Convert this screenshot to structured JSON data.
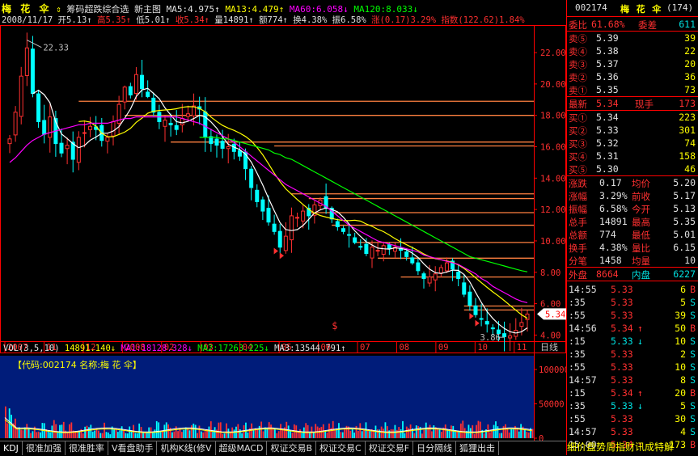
{
  "stock": {
    "name": "梅 花 伞",
    "code": "002174",
    "count": "(174)"
  },
  "header": {
    "indicator_label": "筹码超跌综合选",
    "mode_label": "新主图",
    "ma5": "MA5:4.975↑",
    "ma13": "MA13:4.479↑",
    "ma60": "MA60:6.058↓",
    "ma120": "MA120:8.033↓"
  },
  "quote_line": {
    "date": "2008/11/17",
    "open": "开5.13↑",
    "high": "高5.35↑",
    "low": "低5.01↑",
    "close": "收5.34↑",
    "volume": "量14891↑",
    "amount": "额774↑",
    "turnover": "换4.38%",
    "amplitude": "振6.58%",
    "change": "涨(0.17)3.29%",
    "index": "指数(122.62)1.84%"
  },
  "volume_line": {
    "label": "VOL(3,5,10)",
    "vol": "14891.140↓",
    "ma1": "MA1:18128.328↓",
    "ma2": "MA2:17263.225↓",
    "ma3": "MA3:13544.791↑"
  },
  "volume_banner": "【代码:002174 名称:梅 花 伞】",
  "colors": {
    "up": "#ff3030",
    "down": "#00ffff",
    "ma5": "#ffffff",
    "ma13": "#ffff00",
    "ma60": "#ff00ff",
    "ma120": "#00ff00",
    "level": "#ff8040",
    "axis": "#ff0000"
  },
  "chart_data": {
    "type": "candlestick",
    "y_ticks": [
      "22.00",
      "20.00",
      "18.00",
      "16.00",
      "14.00",
      "12.00",
      "10.00",
      "8.00",
      "6.00",
      "4.00"
    ],
    "ylim": [
      3.3,
      23.6
    ],
    "x_ticks": [
      "2007",
      "11",
      "12",
      "2008",
      "02",
      "03",
      "04",
      "05",
      "06",
      "07",
      "08",
      "09",
      "10",
      "11"
    ],
    "x_axis_label": "日线",
    "annotations": {
      "high": "22.33",
      "low": "3.86",
      "last": "5.34",
      "marker": "$"
    },
    "levels": [
      18.9,
      18.0,
      16.3,
      16.05,
      13.0,
      12.7,
      11.8,
      11.0,
      9.9,
      8.9,
      7.7,
      5.85,
      5.6
    ],
    "closes": [
      16.5,
      18.2,
      20.5,
      22.3,
      19.4,
      17.6,
      16.8,
      17.9,
      16.2,
      15.6,
      16.1,
      15.2,
      16.6,
      16.9,
      17.3,
      17.1,
      16.4,
      16.6,
      17.6,
      18.7,
      19.8,
      19.3,
      20.6,
      19.7,
      19.2,
      18.2,
      17.6,
      17.7,
      17.4,
      17.1,
      17.8,
      18.1,
      18.6,
      18.4,
      16.6,
      16.2,
      16.1,
      15.9,
      16.0,
      15.7,
      15.4,
      14.6,
      13.4,
      12.5,
      11.9,
      11.2,
      10.6,
      9.6,
      10.3,
      11.6,
      11.5,
      11.9,
      11.6,
      12.3,
      12.6,
      12.1,
      11.4,
      10.9,
      10.6,
      10.4,
      9.9,
      9.6,
      9.2,
      9.6,
      9.4,
      9.7,
      9.5,
      9.6,
      9.4,
      9.0,
      8.6,
      8.1,
      7.6,
      7.7,
      7.9,
      8.3,
      8.6,
      8.2,
      7.6,
      6.6,
      5.9,
      5.3,
      5.0,
      4.7,
      4.4,
      4.1,
      3.9,
      3.95,
      4.3,
      4.8,
      5.34
    ],
    "ma60": [
      15.0,
      15.3,
      15.7,
      16.1,
      16.4,
      16.6,
      16.8,
      16.9,
      17.0,
      17.1,
      17.2,
      17.3,
      17.4,
      17.4,
      17.5,
      17.5,
      17.5,
      17.5,
      17.6,
      17.7,
      17.8,
      17.8,
      17.9,
      17.9,
      17.9,
      17.9,
      17.9,
      17.9,
      17.9,
      17.9,
      17.8,
      17.7,
      17.6,
      17.5,
      17.3,
      17.1,
      16.9,
      16.7,
      16.5,
      16.3,
      16.0,
      15.7,
      15.4,
      15.1,
      14.8,
      14.5,
      14.2,
      13.9,
      13.6,
      13.4,
      13.2,
      13.0,
      12.8,
      12.6,
      12.4,
      12.2,
      11.9,
      11.6,
      11.3,
      11.0,
      10.8,
      10.6,
      10.4,
      10.2,
      10.0,
      9.9,
      9.8,
      9.7,
      9.6,
      9.5,
      9.4,
      9.3,
      9.1,
      9.0,
      8.9,
      8.8,
      8.7,
      8.6,
      8.5,
      8.3,
      8.1,
      7.9,
      7.6,
      7.4,
      7.1,
      6.9,
      6.7,
      6.5,
      6.3,
      6.15,
      6.06
    ],
    "ma120": [
      null,
      null,
      null,
      null,
      null,
      null,
      null,
      null,
      null,
      null,
      null,
      null,
      null,
      null,
      null,
      null,
      null,
      null,
      null,
      null,
      null,
      null,
      null,
      null,
      null,
      null,
      null,
      null,
      null,
      null,
      null,
      null,
      null,
      16.6,
      16.6,
      16.6,
      16.6,
      16.5,
      16.5,
      16.4,
      16.3,
      16.2,
      16.1,
      16.0,
      15.9,
      15.8,
      15.6,
      15.5,
      15.3,
      15.2,
      15.0,
      14.8,
      14.6,
      14.4,
      14.2,
      14.0,
      13.8,
      13.6,
      13.4,
      13.2,
      13.0,
      12.8,
      12.6,
      12.4,
      12.2,
      12.0,
      11.8,
      11.6,
      11.4,
      11.2,
      11.0,
      10.8,
      10.6,
      10.4,
      10.2,
      10.0,
      9.8,
      9.6,
      9.4,
      9.2,
      9.0,
      8.9,
      8.8,
      8.7,
      8.6,
      8.5,
      8.4,
      8.3,
      8.2,
      8.1,
      8.03
    ],
    "volume_ticks": [
      "100000",
      "50000",
      "0"
    ],
    "volume_ylim": [
      0,
      120000
    ]
  },
  "tabs": [
    "KDJ",
    "很准加强",
    "很准胜率",
    "V看盘助手",
    "机构K线(修V",
    "超级MACD",
    "权证交易B",
    "权证交易C",
    "权证交易F",
    "日分隔线",
    "狐狸出击"
  ],
  "right_panel": {
    "weibi_label": "委比",
    "weibi": "61.68%",
    "weicha_label": "委差",
    "weicha": "611",
    "sells": [
      {
        "l": "卖⑤",
        "p": "5.39",
        "v": "39"
      },
      {
        "l": "卖④",
        "p": "5.38",
        "v": "22"
      },
      {
        "l": "卖③",
        "p": "5.37",
        "v": "20"
      },
      {
        "l": "卖②",
        "p": "5.36",
        "v": "36"
      },
      {
        "l": "卖①",
        "p": "5.35",
        "v": "73"
      }
    ],
    "latest_label": "最新",
    "latest": "5.34",
    "xianshou_label": "现手",
    "xianshou": "173",
    "buys": [
      {
        "l": "买①",
        "p": "5.34",
        "v": "223"
      },
      {
        "l": "买②",
        "p": "5.33",
        "v": "301"
      },
      {
        "l": "买③",
        "p": "5.32",
        "v": "74"
      },
      {
        "l": "买④",
        "p": "5.31",
        "v": "158"
      },
      {
        "l": "买⑤",
        "p": "5.30",
        "v": "46"
      }
    ],
    "stats": [
      {
        "l1": "涨跌",
        "v1": "0.17",
        "l2": "均价",
        "v2": "5.20"
      },
      {
        "l1": "涨幅",
        "v1": "3.29%",
        "l2": "前收",
        "v2": "5.17"
      },
      {
        "l1": "振幅",
        "v1": "6.58%",
        "l2": "今开",
        "v2": "5.13"
      },
      {
        "l1": "总手",
        "v1": "14891",
        "l2": "最高",
        "v2": "5.35"
      },
      {
        "l1": "总额",
        "v1": "774",
        "l2": "最低",
        "v2": "5.01"
      },
      {
        "l1": "换手",
        "v1": "4.38%",
        "l2": "量比",
        "v2": "6.15"
      },
      {
        "l1": "分笔",
        "v1": "1458",
        "l2": "均量",
        "v2": "10"
      }
    ],
    "waipan_label": "外盘",
    "waipan": "8664",
    "neipan_label": "内盘",
    "neipan": "6227",
    "ticks": [
      {
        "t": "14:55",
        "p": "5.33",
        "a": "",
        "v": "6",
        "s": "B"
      },
      {
        "t": ":35",
        "p": "5.33",
        "a": "",
        "v": "5",
        "s": "S"
      },
      {
        "t": ":55",
        "p": "5.33",
        "a": "",
        "v": "39",
        "s": "S"
      },
      {
        "t": "14:56",
        "p": "5.34",
        "a": "↑",
        "v": "50",
        "s": "B"
      },
      {
        "t": ":15",
        "p": "5.33",
        "a": "↓",
        "v": "10",
        "s": "S"
      },
      {
        "t": ":35",
        "p": "5.33",
        "a": "",
        "v": "2",
        "s": "S"
      },
      {
        "t": ":55",
        "p": "5.33",
        "a": "",
        "v": "10",
        "s": "S"
      },
      {
        "t": "14:57",
        "p": "5.33",
        "a": "",
        "v": "8",
        "s": "S"
      },
      {
        "t": ":15",
        "p": "5.34",
        "a": "↑",
        "v": "20",
        "s": "B"
      },
      {
        "t": ":35",
        "p": "5.33",
        "a": "↓",
        "v": "5",
        "s": "S"
      },
      {
        "t": ":55",
        "p": "5.33",
        "a": "",
        "v": "30",
        "s": "S"
      },
      {
        "t": "14:57",
        "p": "5.33",
        "a": "",
        "v": "4",
        "s": "S"
      },
      {
        "t": "15:00",
        "p": "5.34",
        "a": "↑",
        "v": "173",
        "s": "B"
      }
    ],
    "bottom_bar": "细价盘势周指财讯成特解"
  }
}
